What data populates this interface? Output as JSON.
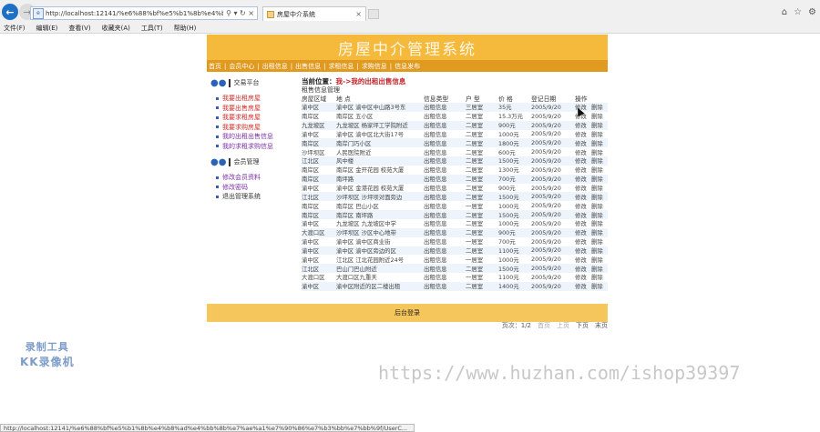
{
  "browser": {
    "url": "http://localhost:12141/%e6%88%bf%e5%b1%8b%e4%b8%ad%e",
    "tab_title": "房屋中介系统",
    "menu": [
      "文件(F)",
      "编辑(E)",
      "查看(V)",
      "收藏夹(A)",
      "工具(T)",
      "帮助(H)"
    ]
  },
  "site": {
    "title": "房屋中介管理系统",
    "nav": [
      "首页",
      "会员中心",
      "出租信息",
      "出售信息",
      "求租信息",
      "求购信息",
      "信息发布"
    ]
  },
  "sidebar": {
    "section1_title": "交易平台",
    "section1_items": [
      {
        "label": "我要出租房屋",
        "color": "red"
      },
      {
        "label": "我要出售房屋",
        "color": "red"
      },
      {
        "label": "我要求租房屋",
        "color": "red"
      },
      {
        "label": "我要求购房屋",
        "color": "red"
      },
      {
        "label": "我的出租出售信息",
        "color": "purple"
      },
      {
        "label": "我的求租求购信息",
        "color": "purple"
      }
    ],
    "section2_title": "会员管理",
    "section2_items": [
      {
        "label": "修改会员资料",
        "color": "purple"
      },
      {
        "label": "修改密码",
        "color": "purple"
      },
      {
        "label": "退出管理系统",
        "color": "dark"
      }
    ]
  },
  "main": {
    "crumb_label": "当前位置：",
    "crumb_value": "我->我的出租出售信息",
    "mgmt_title": "租售信息管理",
    "columns": [
      "房屋区域",
      "地 点",
      "信息类型",
      "户 型",
      "价 格",
      "登记日期",
      "操作"
    ],
    "rows": [
      [
        "渝中区",
        "渝中区  渝中区中山路3号东",
        "出租信息",
        "三居室",
        "35元",
        "2005/9/20"
      ],
      [
        "南岸区",
        "南岸区  五小区",
        "出租信息",
        "二居室",
        "15.3万元",
        "2005/9/20"
      ],
      [
        "九龙坡区",
        "九龙坡区  杨家坪工学院附近",
        "出租信息",
        "二居室",
        "900元",
        "2005/9/20"
      ],
      [
        "渝中区",
        "渝中区  渝中区北大街17号",
        "出租信息",
        "二居室",
        "1000元",
        "2005/9/20"
      ],
      [
        "南岸区",
        "南岸门巧小区",
        "出租信息",
        "二居室",
        "1800元",
        "2005/9/20"
      ],
      [
        "沙坪坝区",
        "人民医院附近",
        "出租信息",
        "二居室",
        "600元",
        "2005/9/20"
      ],
      [
        "江北区",
        "风中楼",
        "出租信息",
        "二居室",
        "1500元",
        "2005/9/20"
      ],
      [
        "南岸区",
        "南岸区  金开花园  校苑大厦",
        "出租信息",
        "二居室",
        "1300元",
        "2005/9/20"
      ],
      [
        "南岸区",
        "南坪路",
        "出租信息",
        "二居室",
        "700元",
        "2005/9/20"
      ],
      [
        "渝中区",
        "渝中区  金港花园  校苑大厦",
        "出租信息",
        "二居室",
        "900元",
        "2005/9/20"
      ],
      [
        "江北区",
        "沙坪坝区  沙坪坝对面旁边",
        "出租信息",
        "二居室",
        "1500元",
        "2005/9/20"
      ],
      [
        "南岸区",
        "南岸区  巴山小区",
        "出租信息",
        "一居室",
        "1000元",
        "2005/9/20"
      ],
      [
        "南岸区",
        "南岸区  南坪路",
        "出租信息",
        "二居室",
        "1500元",
        "2005/9/20"
      ],
      [
        "渝中区",
        "九龙坡区  九龙坡区中学",
        "出租信息",
        "二居室",
        "1000元",
        "2005/9/20"
      ],
      [
        "大渡口区",
        "沙坪坝区  沙区中心地带",
        "出租信息",
        "二居室",
        "900元",
        "2005/9/20"
      ],
      [
        "渝中区",
        "渝中区  渝中区商业街",
        "出租信息",
        "一居室",
        "700元",
        "2005/9/20"
      ],
      [
        "渝中区",
        "渝中区  渝中区旁边的区",
        "出租信息",
        "二居室",
        "1100元",
        "2005/9/20"
      ],
      [
        "渝中区",
        "江北区  江北花园附近24号",
        "出租信息",
        "一居室",
        "1000元",
        "2005/9/20"
      ],
      [
        "江北区",
        "巴山门巴山附近",
        "出租信息",
        "二居室",
        "1500元",
        "2005/9/20"
      ],
      [
        "大渡口区",
        "大渡口区九重天",
        "出租信息",
        "一居室",
        "1100元",
        "2005/9/20"
      ],
      [
        "渝中区",
        "渝中区附近的区二楼出租",
        "出租信息",
        "二居室",
        "1400元",
        "2005/9/20"
      ]
    ],
    "action_edit": "修改",
    "action_delete": "删除",
    "pager": {
      "pages_label": "页次：1/2",
      "first": "首页",
      "prev": "上页",
      "next": "下页",
      "last": "末页"
    }
  },
  "footer": {
    "link": "后台登录"
  },
  "overlays": {
    "watermark_line1": "录制工具",
    "watermark_line2": "KK录像机",
    "watermark_url": "https://www.huzhan.com/ishop39397",
    "status_text": "http://localhost:12141/%e6%88%bf%e5%b1%8b%e4%b8%ad%e4%bb%8b%e7%ae%a1%e7%90%86%e7%b3%bb%e7%bb%9f/UserC..."
  }
}
